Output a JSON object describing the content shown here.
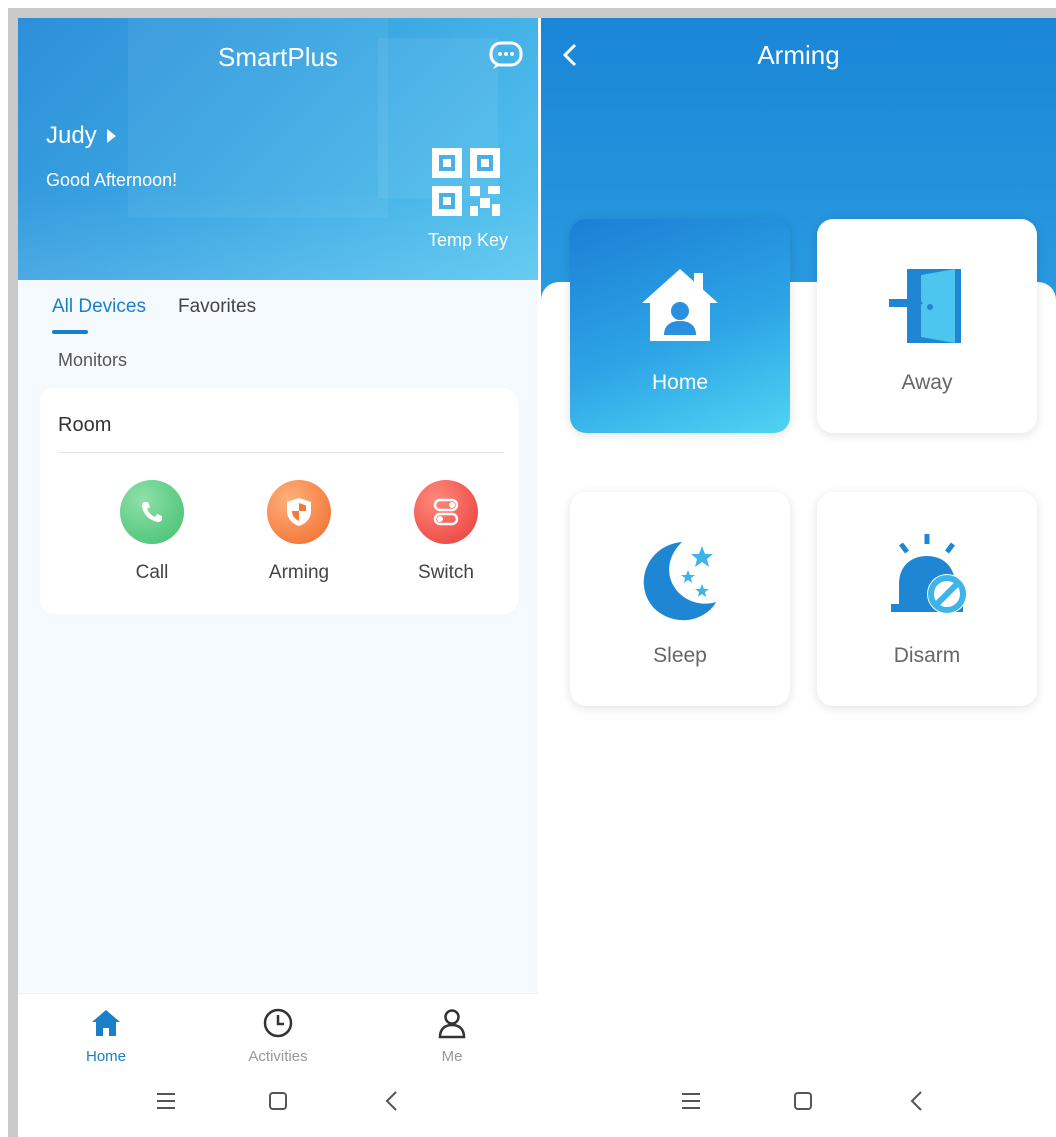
{
  "left_screen": {
    "header": {
      "app_title": "SmartPlus",
      "user_name": "Judy",
      "greeting": "Good Afternoon!",
      "temp_key_label": "Temp Key"
    },
    "tabs": [
      {
        "label": "All Devices",
        "active": true
      },
      {
        "label": "Favorites",
        "active": false
      }
    ],
    "section_label": "Monitors",
    "room": {
      "title": "Room",
      "devices": [
        {
          "label": "Call",
          "icon": "phone-icon",
          "color": "#4cc77a"
        },
        {
          "label": "Arming",
          "icon": "shield-icon",
          "color": "#f27a3a"
        },
        {
          "label": "Switch",
          "icon": "toggle-icon",
          "color": "#ef4a4a"
        }
      ]
    },
    "bottom_nav": [
      {
        "label": "Home",
        "icon": "home-icon",
        "active": true
      },
      {
        "label": "Activities",
        "icon": "clock-icon",
        "active": false
      },
      {
        "label": "Me",
        "icon": "person-icon",
        "active": false
      }
    ]
  },
  "right_screen": {
    "title": "Arming",
    "modes": [
      {
        "label": "Home",
        "icon": "house-icon",
        "selected": true
      },
      {
        "label": "Away",
        "icon": "door-exit-icon",
        "selected": false
      },
      {
        "label": "Sleep",
        "icon": "moon-icon",
        "selected": false
      },
      {
        "label": "Disarm",
        "icon": "alarm-off-icon",
        "selected": false
      }
    ]
  },
  "system_bar": {
    "icons": [
      "menu-icon",
      "home-square-icon",
      "back-icon"
    ]
  },
  "colors": {
    "accent": "#1a7fc8",
    "hero_start": "#2e8fd8",
    "hero_end": "#57c6ef"
  }
}
